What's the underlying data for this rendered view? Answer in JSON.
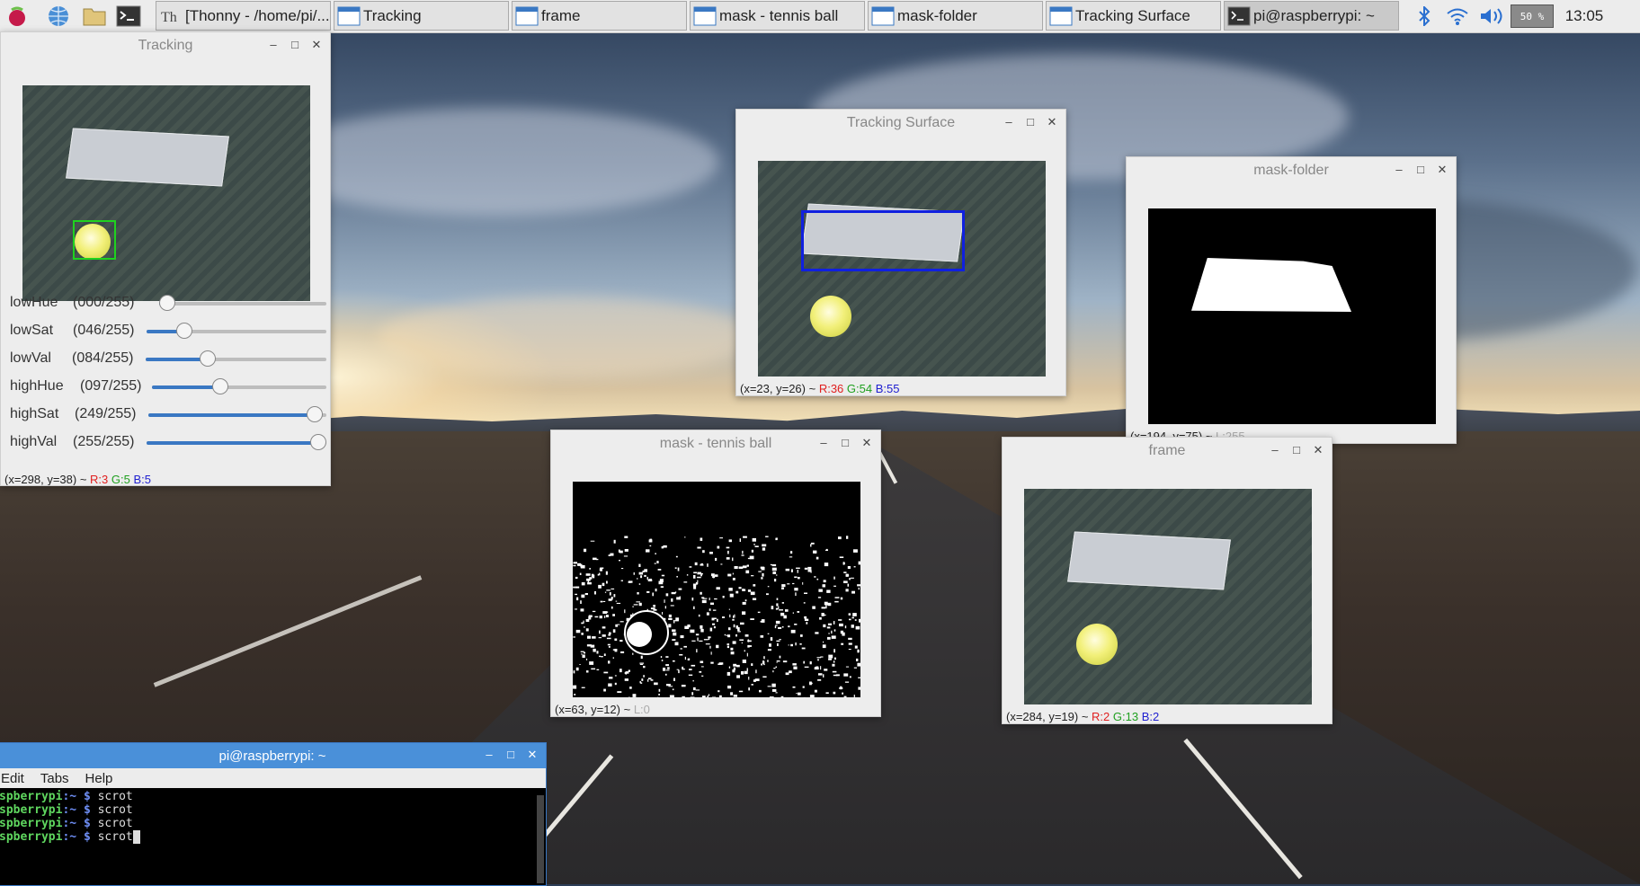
{
  "taskbar": {
    "tasks": [
      {
        "label": "[Thonny  -  /home/pi/..."
      },
      {
        "label": "Tracking"
      },
      {
        "label": "frame"
      },
      {
        "label": "mask - tennis ball"
      },
      {
        "label": "mask-folder"
      },
      {
        "label": "Tracking Surface"
      },
      {
        "label": "pi@raspberrypi: ~"
      }
    ],
    "cpu": "50 %",
    "clock": "13:05"
  },
  "tracking": {
    "title": "Tracking",
    "sliders": [
      {
        "name": "lowHue",
        "value": "(000/255)",
        "level": 0
      },
      {
        "name": "lowSat",
        "value": "(046/255)",
        "level": 46
      },
      {
        "name": "lowVal",
        "value": "(084/255)",
        "level": 84
      },
      {
        "name": "highHue",
        "value": "(097/255)",
        "level": 97
      },
      {
        "name": "highSat",
        "value": "(249/255)",
        "level": 249
      },
      {
        "name": "highVal",
        "value": "(255/255)",
        "level": 255
      }
    ],
    "status": {
      "coords": "(x=298, y=38) ~ ",
      "r": "R:3",
      "g": "G:5",
      "b": "B:5"
    }
  },
  "tracking_surface": {
    "title": "Tracking Surface",
    "status": {
      "coords": "(x=23, y=26) ~ ",
      "r": "R:36",
      "g": "G:54",
      "b": "B:55"
    }
  },
  "mask_folder": {
    "title": "mask-folder",
    "status": {
      "coords": "(x=194, y=75) ~ ",
      "l": "L:255"
    }
  },
  "mask_ball": {
    "title": "mask - tennis ball",
    "status": {
      "coords": "(x=63, y=12) ~ ",
      "l": "L:0"
    }
  },
  "frame": {
    "title": "frame",
    "status": {
      "coords": "(x=284, y=19) ~ ",
      "r": "R:2",
      "g": "G:13",
      "b": "B:2"
    }
  },
  "terminal": {
    "title": "pi@raspberrypi: ~",
    "menu": [
      "Edit",
      "Tabs",
      "Help"
    ],
    "lines": [
      {
        "host": "spberrypi",
        "cwd": ":~ ",
        "prompt": "$ ",
        "cmd": "scrot"
      },
      {
        "host": "spberrypi",
        "cwd": ":~ ",
        "prompt": "$ ",
        "cmd": "scrot"
      },
      {
        "host": "spberrypi",
        "cwd": ":~ ",
        "prompt": "$ ",
        "cmd": "scrot"
      },
      {
        "host": "spberrypi",
        "cwd": ":~ ",
        "prompt": "$ ",
        "cmd": "scrot"
      }
    ]
  },
  "window_buttons": {
    "min": "–",
    "max": "□",
    "close": "✕"
  }
}
